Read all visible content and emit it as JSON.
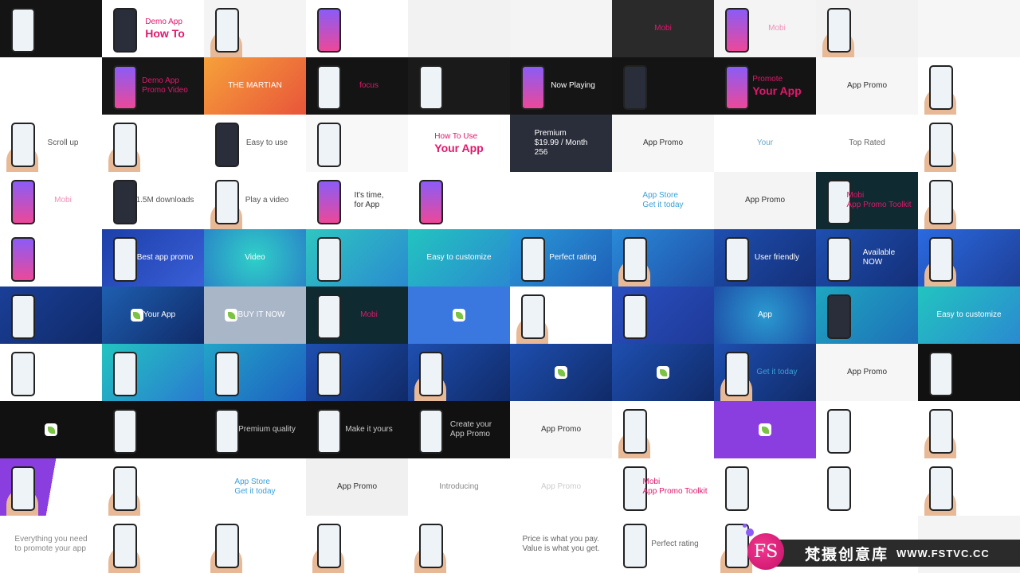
{
  "watermark": {
    "brand_cn": "梵摄创意库",
    "url": "WWW.FSTVC.CC",
    "badge": "FS",
    "badge_color": "#e5267f"
  },
  "cells": [
    {
      "bg": "#141414",
      "lines": [],
      "color": "#fff",
      "phone": "light"
    },
    {
      "bg": "#ffffff",
      "lines": [
        "Demo App",
        "How To"
      ],
      "color": "#e0186c",
      "phone": "dark"
    },
    {
      "bg": "#f4f4f4",
      "lines": [],
      "color": "#333",
      "phone": "hand"
    },
    {
      "bg": "#ffffff",
      "lines": [],
      "color": "#333",
      "phone": "color"
    },
    {
      "bg": "#f2f2f2",
      "lines": [],
      "color": "#333",
      "phone": "none"
    },
    {
      "bg": "#f4f4f4",
      "lines": [],
      "color": "#333",
      "phone": "none"
    },
    {
      "bg": "#2a2a2a",
      "lines": [
        "Mobi"
      ],
      "color": "#e0186c",
      "phone": "none"
    },
    {
      "bg": "#f4f4f4",
      "lines": [
        "Mobi"
      ],
      "color": "#f08fb8",
      "phone": "color"
    },
    {
      "bg": "#f2f2f2",
      "lines": [],
      "color": "#333",
      "phone": "hand"
    },
    {
      "bg": "#f6f6f6",
      "lines": [],
      "color": "#333",
      "phone": "none"
    },
    {
      "bg": "#ffffff",
      "lines": [],
      "color": "#333",
      "phone": "none"
    },
    {
      "bg": "#161616",
      "lines": [
        "Demo App",
        "Promo Video"
      ],
      "color": "#e0186c",
      "phone": "color"
    },
    {
      "bg": "linear-gradient(135deg,#f6a13a,#e8553a)",
      "lines": [
        "THE MARTIAN"
      ],
      "color": "#fff",
      "phone": "none"
    },
    {
      "bg": "#141414",
      "lines": [
        "focus"
      ],
      "color": "#e0186c",
      "phone": "light"
    },
    {
      "bg": "#1a1a1a",
      "lines": [],
      "color": "#fff",
      "phone": "light"
    },
    {
      "bg": "#151515",
      "lines": [
        "Now Playing"
      ],
      "color": "#fff",
      "phone": "color"
    },
    {
      "bg": "#141414",
      "lines": [],
      "color": "#fff",
      "phone": "dark"
    },
    {
      "bg": "#141414",
      "lines": [
        "Promote",
        "Your App"
      ],
      "color": "#e0186c",
      "phone": "color"
    },
    {
      "bg": "#f6f6f6",
      "lines": [
        "App Promo"
      ],
      "color": "#333",
      "phone": "none"
    },
    {
      "bg": "#ffffff",
      "lines": [],
      "color": "#333",
      "phone": "hand"
    },
    {
      "bg": "#ffffff",
      "lines": [
        "Scroll up"
      ],
      "color": "#555",
      "phone": "hand"
    },
    {
      "bg": "#ffffff",
      "lines": [],
      "color": "#555",
      "phone": "hand"
    },
    {
      "bg": "#ffffff",
      "lines": [
        "Easy to use"
      ],
      "color": "#555",
      "phone": "dark"
    },
    {
      "bg": "#f8f8f8",
      "lines": [],
      "color": "#ccc",
      "phone": "light"
    },
    {
      "bg": "#ffffff",
      "lines": [
        "How To Use",
        "Your App"
      ],
      "color": "#e0186c",
      "phone": "none"
    },
    {
      "bg": "#2a2d3a",
      "lines": [
        "Premium",
        "$19.99 / Month",
        "256"
      ],
      "color": "#fff",
      "phone": "none"
    },
    {
      "bg": "#f6f6f6",
      "lines": [
        "App Promo"
      ],
      "color": "#333",
      "phone": "none"
    },
    {
      "bg": "#ffffff",
      "lines": [
        "Your"
      ],
      "color": "#6aa8c8",
      "phone": "none"
    },
    {
      "bg": "#ffffff",
      "lines": [
        "Top Rated"
      ],
      "color": "#666",
      "phone": "none"
    },
    {
      "bg": "#ffffff",
      "lines": [],
      "color": "#333",
      "phone": "hand"
    },
    {
      "bg": "#ffffff",
      "lines": [
        "Mobi"
      ],
      "color": "#f08fb8",
      "phone": "color"
    },
    {
      "bg": "#ffffff",
      "lines": [
        "1.5M downloads"
      ],
      "color": "#555",
      "phone": "dark"
    },
    {
      "bg": "#ffffff",
      "lines": [
        "Play a video"
      ],
      "color": "#555",
      "phone": "hand"
    },
    {
      "bg": "#ffffff",
      "lines": [
        "It's time,",
        "for App"
      ],
      "color": "#333",
      "phone": "color"
    },
    {
      "bg": "#ffffff",
      "lines": [],
      "color": "#333",
      "phone": "color"
    },
    {
      "bg": "#ffffff",
      "lines": [],
      "color": "#333",
      "phone": "none"
    },
    {
      "bg": "#ffffff",
      "lines": [
        "App Store",
        "Get it today"
      ],
      "color": "#3aa0d8",
      "phone": "none"
    },
    {
      "bg": "#f4f4f4",
      "lines": [
        "App Promo"
      ],
      "color": "#333",
      "phone": "none"
    },
    {
      "bg": "#0f2a30",
      "lines": [
        "Mobi",
        "App Promo Toolkit"
      ],
      "color": "#e0186c",
      "phone": "light"
    },
    {
      "bg": "#ffffff",
      "lines": [],
      "color": "#333",
      "phone": "hand"
    },
    {
      "bg": "#ffffff",
      "lines": [],
      "color": "#333",
      "phone": "color"
    },
    {
      "bg": "linear-gradient(135deg,#1c3fa8,#3a5fd8)",
      "lines": [
        "Best app promo"
      ],
      "color": "#fff",
      "phone": "light"
    },
    {
      "bg": "radial-gradient(circle,#2fd0c8,#2a86c8)",
      "lines": [
        "Video"
      ],
      "color": "#fff",
      "phone": "none"
    },
    {
      "bg": "linear-gradient(135deg,#2ec6c0,#2a8ad0)",
      "lines": [],
      "color": "#fff",
      "phone": "light"
    },
    {
      "bg": "linear-gradient(135deg,#22c4c0,#2a8ad0)",
      "lines": [
        "Easy to customize"
      ],
      "color": "#fff",
      "phone": "none"
    },
    {
      "bg": "linear-gradient(135deg,#2a9ad8,#1e5fb8)",
      "lines": [
        "Perfect rating"
      ],
      "color": "#fff",
      "phone": "light"
    },
    {
      "bg": "linear-gradient(135deg,#2a8ad8,#1e4fa8)",
      "lines": [],
      "color": "#fff",
      "phone": "hand"
    },
    {
      "bg": "linear-gradient(135deg,#1e4fb0,#142f78)",
      "lines": [
        "User friendly"
      ],
      "color": "#fff",
      "phone": "light"
    },
    {
      "bg": "linear-gradient(135deg,#1e4fb0,#142f78)",
      "lines": [
        "Available",
        "NOW"
      ],
      "color": "#fff",
      "phone": "light"
    },
    {
      "bg": "linear-gradient(135deg,#2a6ae0,#1e3f98)",
      "lines": [],
      "color": "#fff",
      "phone": "hand"
    },
    {
      "bg": "linear-gradient(135deg,#1a3f98,#102a68)",
      "lines": [],
      "color": "#fff",
      "phone": "light"
    },
    {
      "bg": "linear-gradient(135deg,#1e5fb0,#102a68)",
      "lines": [
        "Your App"
      ],
      "color": "#fff",
      "phone": "logo"
    },
    {
      "bg": "#a9b6c8",
      "lines": [
        "BUY IT NOW"
      ],
      "color": "#fff",
      "phone": "logo"
    },
    {
      "bg": "#0f2a30",
      "lines": [
        "Mobi"
      ],
      "color": "#e0186c",
      "phone": "light"
    },
    {
      "bg": "#3a78e0",
      "lines": [],
      "color": "#fff",
      "phone": "logo"
    },
    {
      "bg": "#ffffff",
      "lines": [],
      "color": "#333",
      "phone": "hand"
    },
    {
      "bg": "linear-gradient(135deg,#2a4fc0,#1e3a98)",
      "lines": [],
      "color": "#fff",
      "phone": "light"
    },
    {
      "bg": "radial-gradient(circle,#2a9ad0,#1e4fa8)",
      "lines": [
        "App"
      ],
      "color": "#fff",
      "phone": "none"
    },
    {
      "bg": "linear-gradient(135deg,#1ea6c0,#1e6fb8)",
      "lines": [],
      "color": "#fff",
      "phone": "dark"
    },
    {
      "bg": "linear-gradient(135deg,#22c4c0,#2a8ad0)",
      "lines": [
        "Easy to customize"
      ],
      "color": "#fff",
      "phone": "none"
    },
    {
      "bg": "#ffffff",
      "lines": [],
      "color": "#333",
      "phone": "light"
    },
    {
      "bg": "linear-gradient(135deg,#22c4c0,#2a7ad0)",
      "lines": [],
      "color": "#fff",
      "phone": "light"
    },
    {
      "bg": "linear-gradient(135deg,#22a4c8,#1e5fc0)",
      "lines": [],
      "color": "#fff",
      "phone": "light"
    },
    {
      "bg": "linear-gradient(135deg,#1e4fb0,#102a68)",
      "lines": [],
      "color": "#fff",
      "phone": "light"
    },
    {
      "bg": "linear-gradient(135deg,#1e4fb0,#102a68)",
      "lines": [],
      "color": "#fff",
      "phone": "hand"
    },
    {
      "bg": "linear-gradient(135deg,#1e4fb0,#102a68)",
      "lines": [],
      "color": "#fff",
      "phone": "logo"
    },
    {
      "bg": "linear-gradient(135deg,#1e4fb0,#102a68)",
      "lines": [],
      "color": "#fff",
      "phone": "logo"
    },
    {
      "bg": "linear-gradient(135deg,#1e4fb0,#102a68)",
      "lines": [
        "Get it today"
      ],
      "color": "#3aa0d8",
      "phone": "hand"
    },
    {
      "bg": "#f6f6f6",
      "lines": [
        "App Promo"
      ],
      "color": "#333",
      "phone": "none"
    },
    {
      "bg": "#111111",
      "lines": [],
      "color": "#fff",
      "phone": "light"
    },
    {
      "bg": "#111111",
      "lines": [],
      "color": "#fff",
      "phone": "logo"
    },
    {
      "bg": "#111111",
      "lines": [],
      "color": "#fff",
      "phone": "light"
    },
    {
      "bg": "#111111",
      "lines": [
        "Premium quality"
      ],
      "color": "#ccc",
      "phone": "light"
    },
    {
      "bg": "#111111",
      "lines": [
        "Make it yours"
      ],
      "color": "#ccc",
      "phone": "light"
    },
    {
      "bg": "#111111",
      "lines": [
        "Create your",
        "App Promo"
      ],
      "color": "#ccc",
      "phone": "light"
    },
    {
      "bg": "#f6f6f6",
      "lines": [
        "App Promo"
      ],
      "color": "#333",
      "phone": "none"
    },
    {
      "bg": "#ffffff",
      "lines": [],
      "color": "#333",
      "phone": "hand"
    },
    {
      "bg": "#8a3ee0",
      "lines": [],
      "color": "#fff",
      "phone": "logo"
    },
    {
      "bg": "#ffffff",
      "lines": [],
      "color": "#555",
      "phone": "light"
    },
    {
      "bg": "#ffffff",
      "lines": [],
      "color": "#333",
      "phone": "hand"
    },
    {
      "bg": "linear-gradient(100deg,#8a3ee0 50%,#ffffff 50%)",
      "lines": [],
      "color": "#333",
      "phone": "hand"
    },
    {
      "bg": "#ffffff",
      "lines": [],
      "color": "#333",
      "phone": "hand"
    },
    {
      "bg": "#ffffff",
      "lines": [
        "App Store",
        "Get it today"
      ],
      "color": "#3aa0d8",
      "phone": "none"
    },
    {
      "bg": "#f0f0f0",
      "lines": [
        "App Promo"
      ],
      "color": "#333",
      "phone": "none"
    },
    {
      "bg": "#ffffff",
      "lines": [
        "Introducing"
      ],
      "color": "#888",
      "phone": "none"
    },
    {
      "bg": "#ffffff",
      "lines": [
        "App Promo"
      ],
      "color": "#ccc",
      "phone": "none"
    },
    {
      "bg": "#ffffff",
      "lines": [
        "Mobi",
        "App Promo Toolkit"
      ],
      "color": "#e0186c",
      "phone": "light"
    },
    {
      "bg": "#ffffff",
      "lines": [],
      "color": "#333",
      "phone": "light"
    },
    {
      "bg": "#ffffff",
      "lines": [],
      "color": "#ccc",
      "phone": "light"
    },
    {
      "bg": "#ffffff",
      "lines": [],
      "color": "#333",
      "phone": "hand"
    },
    {
      "bg": "#ffffff",
      "lines": [
        "Everything you need",
        "to promote your app"
      ],
      "color": "#888",
      "phone": "none"
    },
    {
      "bg": "#ffffff",
      "lines": [],
      "color": "#333",
      "phone": "hand"
    },
    {
      "bg": "#ffffff",
      "lines": [],
      "color": "#333",
      "phone": "hand"
    },
    {
      "bg": "#ffffff",
      "lines": [],
      "color": "#333",
      "phone": "hand"
    },
    {
      "bg": "#ffffff",
      "lines": [],
      "color": "#333",
      "phone": "hand"
    },
    {
      "bg": "#ffffff",
      "lines": [
        "Price is what you pay.",
        "Value is what you get."
      ],
      "color": "#666",
      "phone": "none"
    },
    {
      "bg": "#ffffff",
      "lines": [
        "Perfect rating"
      ],
      "color": "#666",
      "phone": "light"
    },
    {
      "bg": "#ffffff",
      "lines": [
        "Get it today"
      ],
      "color": "#3aa0d8",
      "phone": "hand"
    },
    {
      "bg": "#ffffff",
      "lines": [],
      "color": "#333",
      "phone": "none"
    },
    {
      "bg": "#f4f4f4",
      "lines": [],
      "color": "#333",
      "phone": "none"
    },
    {
      "bg": "#ffffff",
      "lines": [],
      "color": "#333",
      "phone": "none"
    }
  ]
}
